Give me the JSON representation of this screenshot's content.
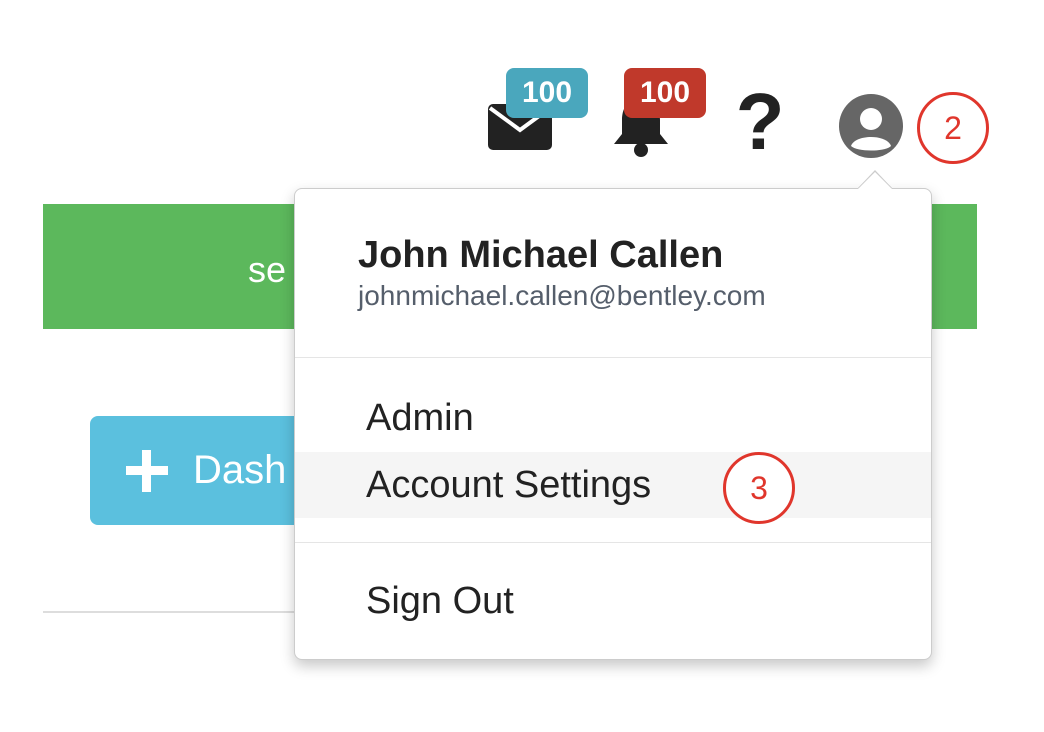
{
  "navbar": {
    "messages": {
      "icon": "envelope-icon",
      "badge": "100",
      "badge_color": "#4aa7bd"
    },
    "notifications": {
      "icon": "bell-icon",
      "badge": "100",
      "badge_color": "#c0392b"
    },
    "help": {
      "icon": "question-icon",
      "glyph": "?"
    },
    "user": {
      "icon": "user-circle-icon"
    }
  },
  "background": {
    "banner_text": "se",
    "banner_color": "#5cb85c",
    "dash_button": {
      "icon": "plus-icon",
      "label": "Dash",
      "color": "#5bc0de"
    }
  },
  "user_menu": {
    "name": "John Michael Callen",
    "email": "johnmichael.callen@bentley.com",
    "items": [
      {
        "label": "Admin"
      },
      {
        "label": "Account Settings",
        "highlighted": true
      },
      {
        "label": "Sign Out"
      }
    ]
  },
  "annotations": {
    "step_2": "2",
    "step_3": "3",
    "color": "#e0362c"
  }
}
